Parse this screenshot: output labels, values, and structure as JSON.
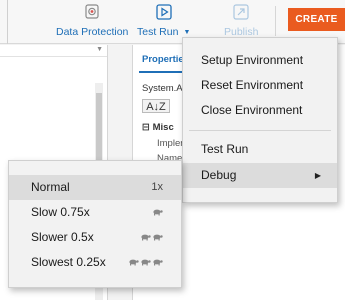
{
  "ribbon": {
    "items": [
      {
        "label": "Data Protection",
        "icon": "data-protection-icon"
      },
      {
        "label": "Test Run",
        "icon": "test-run-icon"
      },
      {
        "label": "Publish",
        "icon": "publish-icon"
      }
    ],
    "create_label": "CREATE"
  },
  "properties": {
    "tab_label": "Properties",
    "object_name": "System.Ac",
    "sort_label": "A↓Z",
    "category": "Misc",
    "rows": [
      "Impler",
      "Name"
    ]
  },
  "test_run_menu": {
    "items": [
      "Setup Environment",
      "Reset Environment",
      "Close Environment",
      "Test Run",
      "Debug"
    ],
    "highlighted": "Debug"
  },
  "debug_menu": {
    "items": [
      {
        "label": "Normal",
        "speed": "1x",
        "turtles": 0
      },
      {
        "label": "Slow 0.75x",
        "speed": "",
        "turtles": 1
      },
      {
        "label": "Slower 0.5x",
        "speed": "",
        "turtles": 2
      },
      {
        "label": "Slowest 0.25x",
        "speed": "",
        "turtles": 3
      }
    ],
    "highlighted": "Normal"
  },
  "colors": {
    "accent": "#1f6fb7",
    "create": "#ea5b1f"
  }
}
